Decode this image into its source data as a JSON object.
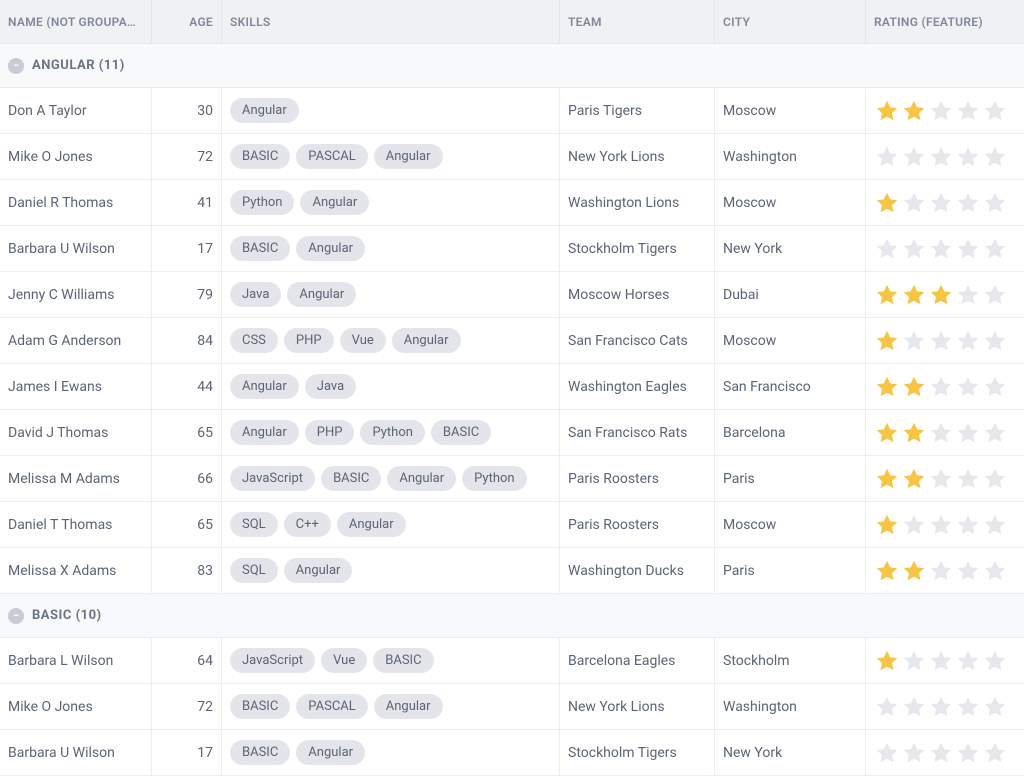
{
  "columns": {
    "name": "NAME (NOT GROUPA…",
    "age": "AGE",
    "skills": "SKILLS",
    "team": "TEAM",
    "city": "CITY",
    "rating": "RATING (FEATURE)"
  },
  "groups": [
    {
      "label": "ANGULAR (11)",
      "rows": [
        {
          "name": "Don A Taylor",
          "age": "30",
          "skills": [
            "Angular"
          ],
          "team": "Paris Tigers",
          "city": "Moscow",
          "rating": 2
        },
        {
          "name": "Mike O Jones",
          "age": "72",
          "skills": [
            "BASIC",
            "PASCAL",
            "Angular"
          ],
          "team": "New York Lions",
          "city": "Washington",
          "rating": 0
        },
        {
          "name": "Daniel R Thomas",
          "age": "41",
          "skills": [
            "Python",
            "Angular"
          ],
          "team": "Washington Lions",
          "city": "Moscow",
          "rating": 1
        },
        {
          "name": "Barbara U Wilson",
          "age": "17",
          "skills": [
            "BASIC",
            "Angular"
          ],
          "team": "Stockholm Tigers",
          "city": "New York",
          "rating": 0
        },
        {
          "name": "Jenny C Williams",
          "age": "79",
          "skills": [
            "Java",
            "Angular"
          ],
          "team": "Moscow Horses",
          "city": "Dubai",
          "rating": 3
        },
        {
          "name": "Adam G Anderson",
          "age": "84",
          "skills": [
            "CSS",
            "PHP",
            "Vue",
            "Angular"
          ],
          "team": "San Francisco Cats",
          "city": "Moscow",
          "rating": 1
        },
        {
          "name": "James I Ewans",
          "age": "44",
          "skills": [
            "Angular",
            "Java"
          ],
          "team": "Washington Eagles",
          "city": "San Francisco",
          "rating": 2
        },
        {
          "name": "David J Thomas",
          "age": "65",
          "skills": [
            "Angular",
            "PHP",
            "Python",
            "BASIC"
          ],
          "team": "San Francisco Rats",
          "city": "Barcelona",
          "rating": 2
        },
        {
          "name": "Melissa M Adams",
          "age": "66",
          "skills": [
            "JavaScript",
            "BASIC",
            "Angular",
            "Python"
          ],
          "team": "Paris Roosters",
          "city": "Paris",
          "rating": 2
        },
        {
          "name": "Daniel T Thomas",
          "age": "65",
          "skills": [
            "SQL",
            "C++",
            "Angular"
          ],
          "team": "Paris Roosters",
          "city": "Moscow",
          "rating": 1
        },
        {
          "name": "Melissa X Adams",
          "age": "83",
          "skills": [
            "SQL",
            "Angular"
          ],
          "team": "Washington Ducks",
          "city": "Paris",
          "rating": 2
        }
      ]
    },
    {
      "label": "BASIC (10)",
      "rows": [
        {
          "name": "Barbara L Wilson",
          "age": "64",
          "skills": [
            "JavaScript",
            "Vue",
            "BASIC"
          ],
          "team": "Barcelona Eagles",
          "city": "Stockholm",
          "rating": 1
        },
        {
          "name": "Mike O Jones",
          "age": "72",
          "skills": [
            "BASIC",
            "PASCAL",
            "Angular"
          ],
          "team": "New York Lions",
          "city": "Washington",
          "rating": 0
        },
        {
          "name": "Barbara U Wilson",
          "age": "17",
          "skills": [
            "BASIC",
            "Angular"
          ],
          "team": "Stockholm Tigers",
          "city": "New York",
          "rating": 0
        }
      ]
    }
  ]
}
